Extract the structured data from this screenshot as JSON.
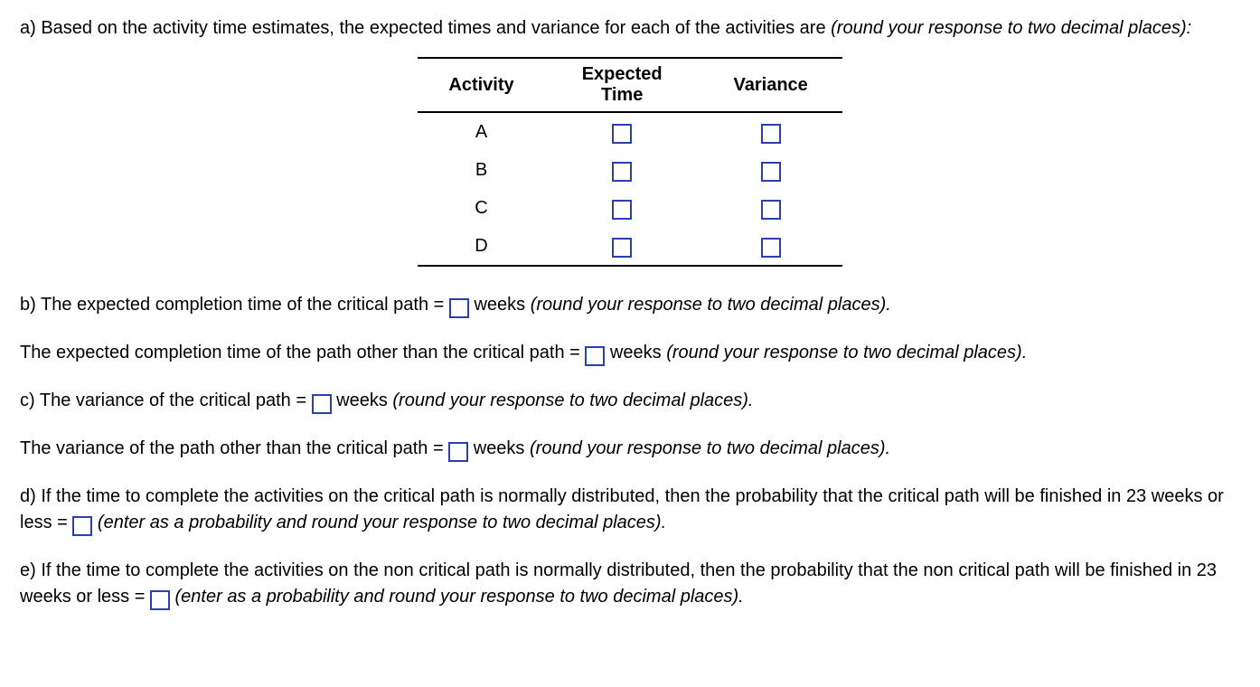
{
  "partA": {
    "prefix": "a) Based on the activity time estimates, the expected times and variance for each of the activities are ",
    "hint": "(round your response to two decimal places):"
  },
  "table": {
    "headers": {
      "c1": "Activity",
      "c2": "Expected Time",
      "c3": "Variance"
    },
    "rows": [
      {
        "activity": "A",
        "expected": "",
        "variance": ""
      },
      {
        "activity": "B",
        "expected": "",
        "variance": ""
      },
      {
        "activity": "C",
        "expected": "",
        "variance": ""
      },
      {
        "activity": "D",
        "expected": "",
        "variance": ""
      }
    ]
  },
  "partB": {
    "line1_pre": "b) The expected completion time of the critical path = ",
    "line1_unit": " weeks ",
    "line1_hint": "(round your response to two decimal places).",
    "line2_pre": "The expected completion time of the path other than the critical path = ",
    "line2_unit": " weeks ",
    "line2_hint": "(round your response to two decimal places)."
  },
  "partC": {
    "line1_pre": "c) The variance of the critical path = ",
    "line1_unit": " weeks ",
    "line1_hint": "(round your response to two decimal places).",
    "line2_pre": "The variance of the path other than the critical path = ",
    "line2_unit": " weeks ",
    "line2_hint": "(round your response to two decimal places)."
  },
  "partD": {
    "pre": "d) If the time to complete the activities on the critical path is normally distributed, then the probability that the critical path will be finished in 23 weeks or less = ",
    "hint": " (enter as a probability and round your response to two decimal places)."
  },
  "partE": {
    "pre": "e) If the time to complete the activities on the non critical path is normally distributed, then the probability that the non critical path will be finished in 23 weeks or less = ",
    "hint": " (enter as a probability and round your response to two decimal places)."
  }
}
